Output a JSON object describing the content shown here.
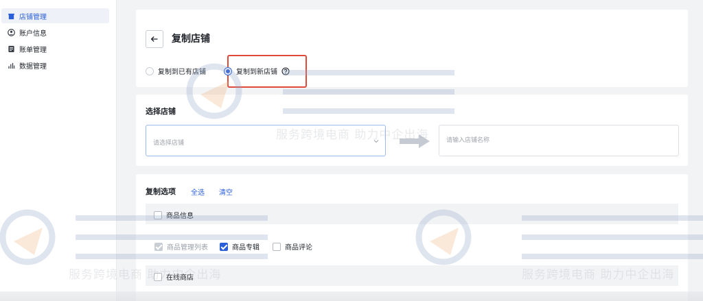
{
  "sidebar": {
    "items": [
      {
        "label": "店铺管理",
        "icon": "store-icon",
        "active": true
      },
      {
        "label": "账户信息",
        "icon": "user-circle-icon",
        "active": false
      },
      {
        "label": "账单管理",
        "icon": "bill-icon",
        "active": false
      },
      {
        "label": "数据管理",
        "icon": "bar-chart-icon",
        "active": false
      }
    ]
  },
  "header": {
    "title": "复制店铺",
    "back_icon": "arrow-left-icon"
  },
  "copy_mode": {
    "options": [
      {
        "label": "复制到已有店铺",
        "checked": false
      },
      {
        "label": "复制到新店铺",
        "checked": true
      }
    ],
    "help_icon": "question-circle-icon"
  },
  "select_store": {
    "label": "选择店铺",
    "select_placeholder": "请选择店铺",
    "input_placeholder": "请输入店铺名称"
  },
  "copy_options": {
    "label": "复制选项",
    "select_all": "全选",
    "clear": "清空",
    "groups": [
      {
        "header": "商品信息",
        "items": [
          {
            "label": "商品管理列表",
            "state": "disabled-checked"
          },
          {
            "label": "商品专辑",
            "state": "checked"
          },
          {
            "label": "商品评论",
            "state": "unchecked"
          }
        ]
      },
      {
        "header": "在线商店"
      }
    ]
  },
  "watermark": {
    "text": "服务跨境电商 助力中企出海"
  },
  "colors": {
    "accent": "#2b5fd9",
    "highlight": "#e04a3b",
    "background": "#f2f3f5"
  }
}
